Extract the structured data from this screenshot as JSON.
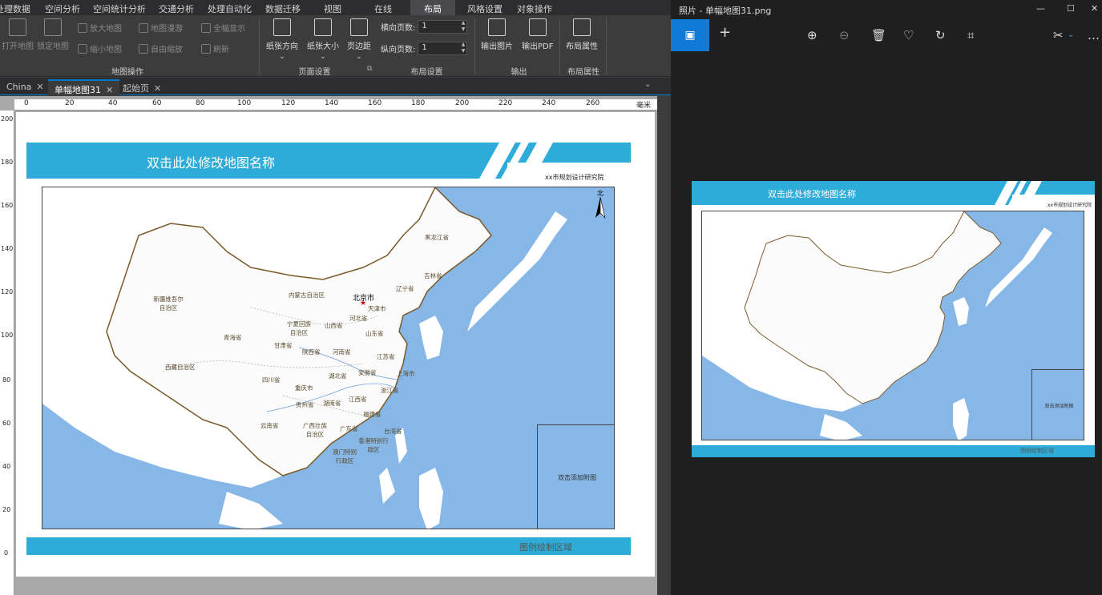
{
  "menu": [
    "处理数据",
    "空间分析",
    "空间统计分析",
    "交通分析",
    "处理自动化",
    "数据迁移",
    "视图",
    "在线",
    "布局",
    "风格设置",
    "对象操作"
  ],
  "ribbon": {
    "map_ops": {
      "open_map": "打开地图",
      "lock_map": "锁定地图",
      "zoom_in": "放大地图",
      "zoom_out": "缩小地图",
      "pan_map": "地图漫游",
      "free_zoom": "自由缩放",
      "full_extent": "全幅显示",
      "refresh": "刷新",
      "group": "地图操作"
    },
    "page_setup": {
      "orientation": "纸张方向",
      "size": "纸张大小",
      "margins": "页边距",
      "group": "页面设置"
    },
    "layout_settings": {
      "h_pages_label": "横向页数:",
      "h_pages_value": "1",
      "v_pages_label": "纵向页数:",
      "v_pages_value": "1",
      "group": "布局设置"
    },
    "output": {
      "export_image": "输出图片",
      "export_pdf": "输出PDF",
      "group": "输出"
    },
    "layout_props": {
      "label": "布局属性",
      "group": "布局属性"
    }
  },
  "tabs": [
    {
      "label": "China"
    },
    {
      "label": "单幅地图31"
    },
    {
      "label": "起始页"
    }
  ],
  "ruler": {
    "h_ticks": [
      "0",
      "20",
      "40",
      "60",
      "80",
      "100",
      "120",
      "140",
      "160",
      "180",
      "200",
      "220",
      "240",
      "260"
    ],
    "h_unit": "毫米",
    "v_ticks": [
      "200",
      "180",
      "160",
      "140",
      "120",
      "100",
      "80",
      "60",
      "40",
      "20",
      "0"
    ]
  },
  "layout": {
    "map_title": "双击此处修改地图名称",
    "publisher": "xx市规划设计研究院",
    "inset_label": "双击添加附图",
    "footer_label": "图例绘制区域",
    "north": "北",
    "capital": "北京市"
  },
  "provinces": [
    "黑龙江省",
    "吉林省",
    "辽宁省",
    "内蒙古自治区",
    "新疆维吾尔自治区",
    "天津市",
    "河北省",
    "山西省",
    "宁夏回族自治区",
    "青海省",
    "甘肃省",
    "陕西省",
    "河南省",
    "山东省",
    "西藏自治区",
    "江苏省",
    "四川省",
    "湖北省",
    "安徽省",
    "上海市",
    "重庆市",
    "浙江省",
    "贵州省",
    "湖南省",
    "江西省",
    "福建省",
    "云南省",
    "广西壮族自治区",
    "广东省",
    "台湾省",
    "香港特别行政区",
    "澳门特别行政区"
  ],
  "photos": {
    "window_title": "照片 - 单幅地图31.png",
    "thumb_title": "双击此处修改地图名称",
    "thumb_publisher": "xx市规划设计研究院",
    "thumb_inset_label": "双击添加附图",
    "thumb_footer_label": "图例绘制区域"
  },
  "colors": {
    "banner": "#2eacd9",
    "sea": "#86b7e6",
    "land": "#ffffff",
    "ribbon_bg": "#3c3c3c",
    "accent": "#0f7bd6"
  }
}
